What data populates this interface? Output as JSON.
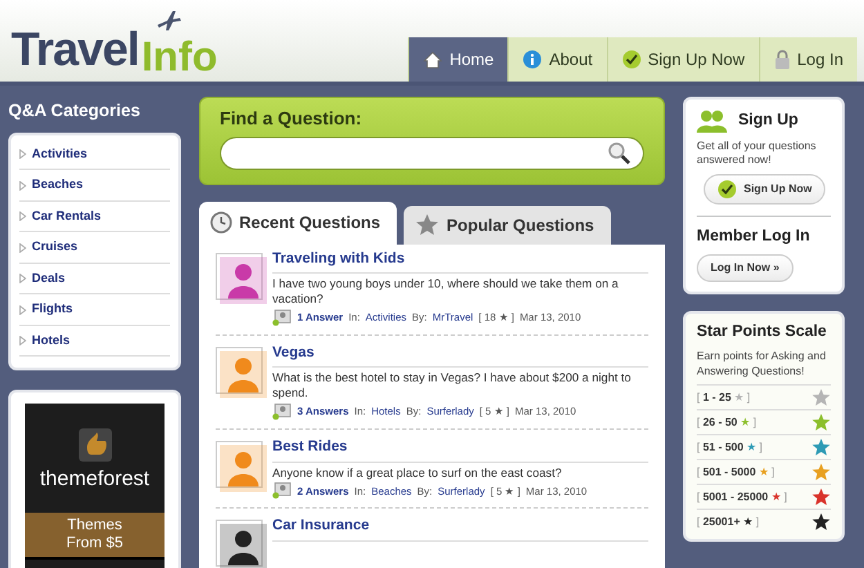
{
  "logo": {
    "first": "Travel",
    "second": "Info"
  },
  "nav": [
    {
      "label": "Home",
      "selected": true
    },
    {
      "label": "About",
      "selected": false
    },
    {
      "label": "Sign Up Now",
      "selected": false
    },
    {
      "label": "Log In",
      "selected": false
    }
  ],
  "categories": {
    "title": "Q&A Categories",
    "items": [
      "Activities",
      "Beaches",
      "Car Rentals",
      "Cruises",
      "Deals",
      "Flights",
      "Hotels"
    ]
  },
  "ad": {
    "brand": "themeforest",
    "lines": [
      "Themes",
      "From $5"
    ]
  },
  "search": {
    "title": "Find a Question:"
  },
  "tabs": [
    {
      "label": "Recent Questions",
      "selected": true
    },
    {
      "label": "Popular Questions",
      "selected": false
    }
  ],
  "questions": [
    {
      "title": "Traveling with Kids",
      "text": "I have two young boys under 10, where should we take them on a vacation?",
      "answers": "1 Answer",
      "in_label": "In:",
      "category": "Activities",
      "by_label": "By:",
      "author": "MrTravel",
      "points": "[ 18 ★ ]",
      "date": "Mar 13, 2010",
      "color": "#c93aa8"
    },
    {
      "title": "Vegas",
      "text": "What is the best hotel to stay in Vegas? I have about $200 a night to spend.",
      "answers": "3 Answers",
      "in_label": "In:",
      "category": "Hotels",
      "by_label": "By:",
      "author": "Surferlady",
      "points": "[ 5 ★ ]",
      "date": "Mar 13, 2010",
      "color": "#f08a1c"
    },
    {
      "title": "Best Rides",
      "text": "Anyone know if a great place to surf on the east coast?",
      "answers": "2 Answers",
      "in_label": "In:",
      "category": "Beaches",
      "by_label": "By:",
      "author": "Surferlady",
      "points": "[ 5 ★ ]",
      "date": "Mar 13, 2010",
      "color": "#f08a1c"
    },
    {
      "title": "Car Insurance",
      "color": "#222222"
    }
  ],
  "signup": {
    "title": "Sign Up",
    "text": "Get all of your questions answered now!",
    "button": "Sign Up Now"
  },
  "login": {
    "title": "Member Log In",
    "button": "Log In Now »"
  },
  "scale": {
    "title": "Star Points Scale",
    "text": "Earn points for Asking and Answering Questions!",
    "levels": [
      {
        "open": "[",
        "range": "1 - 25",
        "star": "★",
        "close": "]",
        "color": "#b5b5b5"
      },
      {
        "open": "[",
        "range": "26 - 50",
        "star": "★",
        "close": "]",
        "color": "#8cbf2c"
      },
      {
        "open": "[",
        "range": "51 - 500",
        "star": "★",
        "close": "]",
        "color": "#2d9bb5"
      },
      {
        "open": "[",
        "range": "501 - 5000",
        "star": "★",
        "close": "]",
        "color": "#e8a020"
      },
      {
        "open": "[",
        "range": "5001 - 25000",
        "star": "★",
        "close": "]",
        "color": "#d9332b"
      },
      {
        "open": "[",
        "range": "25001+",
        "star": "★",
        "close": "]",
        "color": "#222222"
      }
    ]
  }
}
